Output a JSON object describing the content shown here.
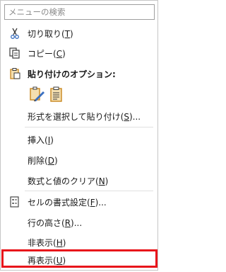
{
  "search": {
    "placeholder": "メニューの検索"
  },
  "items": {
    "cut": {
      "label_pre": "切り取り(",
      "key": "T",
      "label_post": ")"
    },
    "copy": {
      "label_pre": "コピー(",
      "key": "C",
      "label_post": ")"
    },
    "paste_options": {
      "label": "貼り付けのオプション:"
    },
    "paste_special": {
      "label_pre": "形式を選択して貼り付け(",
      "key": "S",
      "label_post": ")..."
    },
    "insert": {
      "label_pre": "挿入(",
      "key": "I",
      "label_post": ")"
    },
    "delete": {
      "label_pre": "削除(",
      "key": "D",
      "label_post": ")"
    },
    "clear": {
      "label_pre": "数式と値のクリア(",
      "key": "N",
      "label_post": ")"
    },
    "format_cells": {
      "label_pre": "セルの書式設定(",
      "key": "F",
      "label_post": ")..."
    },
    "row_height": {
      "label_pre": "行の高さ(",
      "key": "R",
      "label_post": ")..."
    },
    "hide": {
      "label_pre": "非表示(",
      "key": "H",
      "label_post": ")"
    },
    "unhide": {
      "label_pre": "再表示(",
      "key": "U",
      "label_post": ")"
    }
  },
  "icons": {
    "cut": "scissors-icon",
    "copy": "copy-icon",
    "paste": "clipboard-icon",
    "paste_formatting": "paste-formatting-icon",
    "paste_values": "paste-values-icon",
    "format_cells": "format-cells-icon"
  },
  "colors": {
    "highlight": "#e8151b",
    "icon_orange": "#c8861d",
    "icon_blue": "#3a6fbf"
  }
}
